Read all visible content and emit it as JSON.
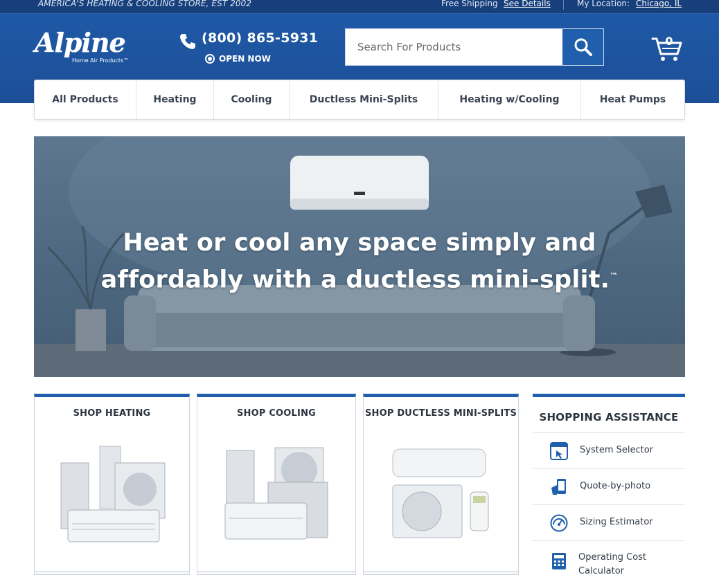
{
  "topbar": {
    "tagline": "AMERICA'S HEATING & COOLING STORE, EST 2002",
    "free_shipping": "Free Shipping",
    "see_details": "See Details",
    "location_label": "My Location:",
    "location_value": "Chicago, IL"
  },
  "logo": {
    "wordmark": "Alpine",
    "subtitle": "Home Air Products™"
  },
  "header": {
    "phone": "(800) 865-5931",
    "status": "OPEN NOW",
    "search_placeholder": "Search For Products",
    "cart_count": "0"
  },
  "nav": {
    "items": [
      {
        "label": "All Products"
      },
      {
        "label": "Heating"
      },
      {
        "label": "Cooling"
      },
      {
        "label": "Ductless Mini-Splits"
      },
      {
        "label": "Heating w/Cooling"
      },
      {
        "label": "Heat Pumps"
      }
    ]
  },
  "hero": {
    "line1": "Heat or cool any space simply and",
    "line2": "affordably with a ductless mini-split.",
    "trademark": "™"
  },
  "cards": [
    {
      "title": "SHOP HEATING"
    },
    {
      "title": "SHOP COOLING"
    },
    {
      "title": "SHOP DUCTLESS MINI-SPLITS"
    }
  ],
  "assistance": {
    "title": "SHOPPING ASSISTANCE",
    "items": [
      {
        "label": "System Selector",
        "icon": "system-selector-icon"
      },
      {
        "label": "Quote-by-photo",
        "icon": "quote-photo-icon"
      },
      {
        "label": "Sizing Estimator",
        "icon": "sizing-gauge-icon"
      },
      {
        "label": "Operating Cost Calculator",
        "icon": "calculator-icon"
      }
    ]
  },
  "colors": {
    "brand_blue": "#1f5fab",
    "header_blue": "#1d4f98",
    "text_dark": "#2c3440"
  }
}
